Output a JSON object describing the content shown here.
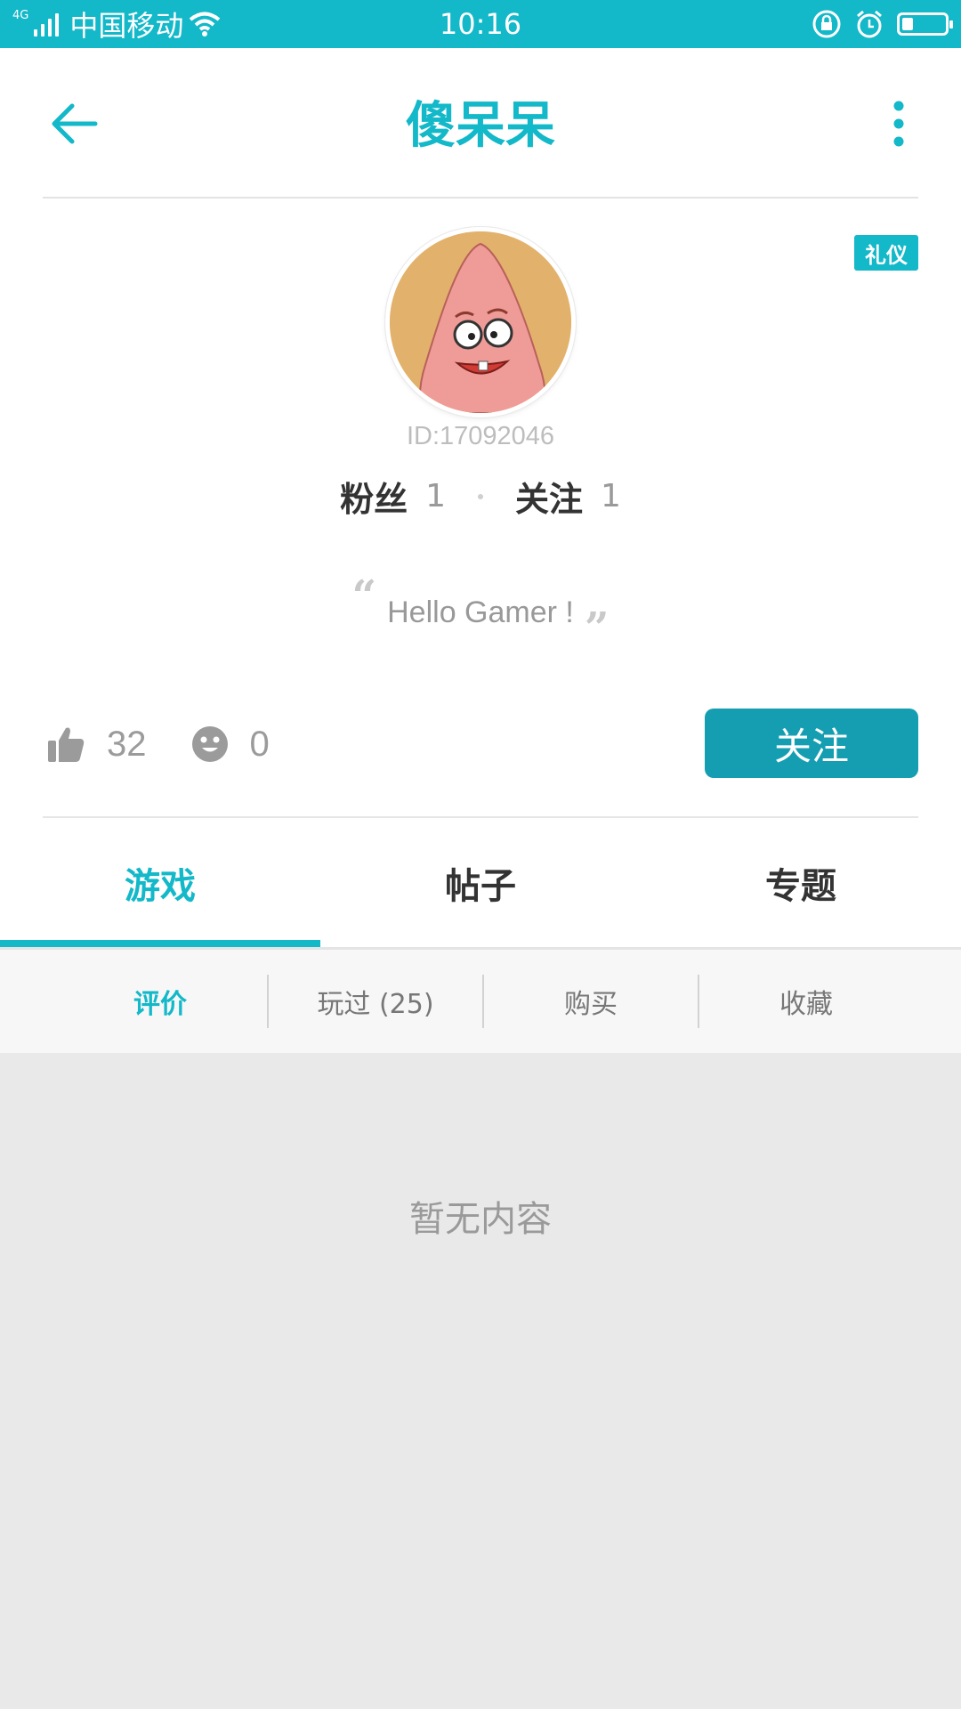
{
  "status_bar": {
    "carrier": "中国移动",
    "network": "4G",
    "time": "10:16",
    "battery_level": 0.25
  },
  "header": {
    "title": "傻呆呆",
    "back_icon": "arrow-left-icon",
    "more_icon": "more-vertical-icon"
  },
  "profile": {
    "badge": "礼仪",
    "user_id": "ID:17092046",
    "fans_label": "粉丝",
    "fans_count": "1",
    "following_label": "关注",
    "following_count": "1",
    "bio": "Hello Gamer !"
  },
  "reactions": {
    "likes": "32",
    "smiles": "0"
  },
  "follow_button": "关注",
  "tabs": [
    {
      "label": "游戏",
      "active": true
    },
    {
      "label": "帖子",
      "active": false
    },
    {
      "label": "专题",
      "active": false
    }
  ],
  "subtabs": [
    {
      "label": "评价",
      "active": true
    },
    {
      "label": "玩过 (25)",
      "active": false
    },
    {
      "label": "购买",
      "active": false
    },
    {
      "label": "收藏",
      "active": false
    }
  ],
  "empty_text": "暂无内容",
  "colors": {
    "accent": "#13b8c9",
    "button": "#159eb2"
  }
}
